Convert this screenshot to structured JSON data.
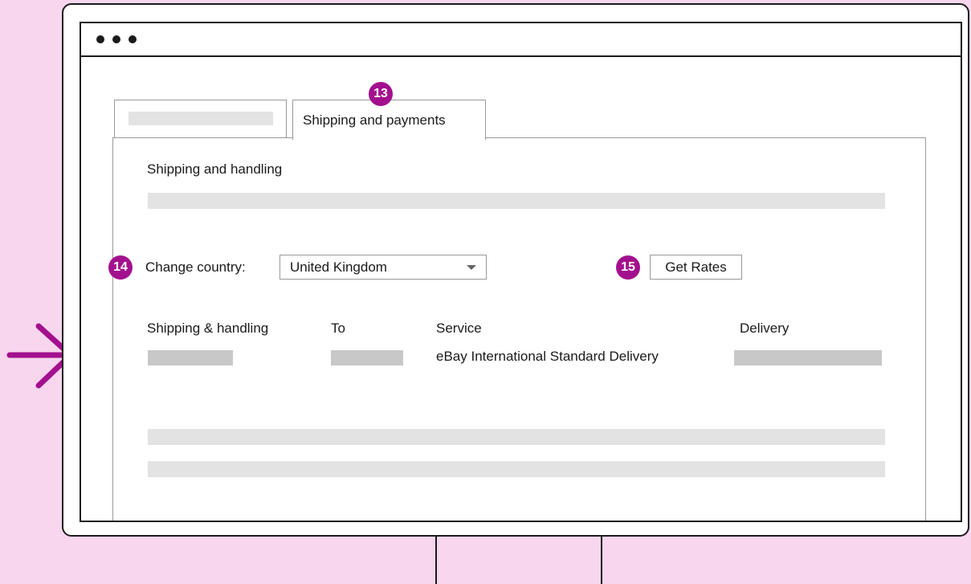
{
  "colors": {
    "background": "#f8d6ee",
    "accent": "#a3108e",
    "placeholder_light": "#e3e3e3",
    "placeholder_dark": "#c8c8c8"
  },
  "tabs": {
    "active_label": "Shipping and payments",
    "active_badge": "13"
  },
  "section": {
    "title": "Shipping and handling"
  },
  "country": {
    "badge": "14",
    "label": "Change country:",
    "selected": "United Kingdom"
  },
  "rates": {
    "badge": "15",
    "button_label": "Get Rates"
  },
  "table": {
    "headers": [
      "Shipping & handling",
      "To",
      "Service",
      "Delivery"
    ],
    "row": {
      "service": "eBay International Standard Delivery"
    }
  },
  "icons": {
    "pointer": "arrow-right-icon",
    "dropdown": "chevron-down-icon"
  }
}
